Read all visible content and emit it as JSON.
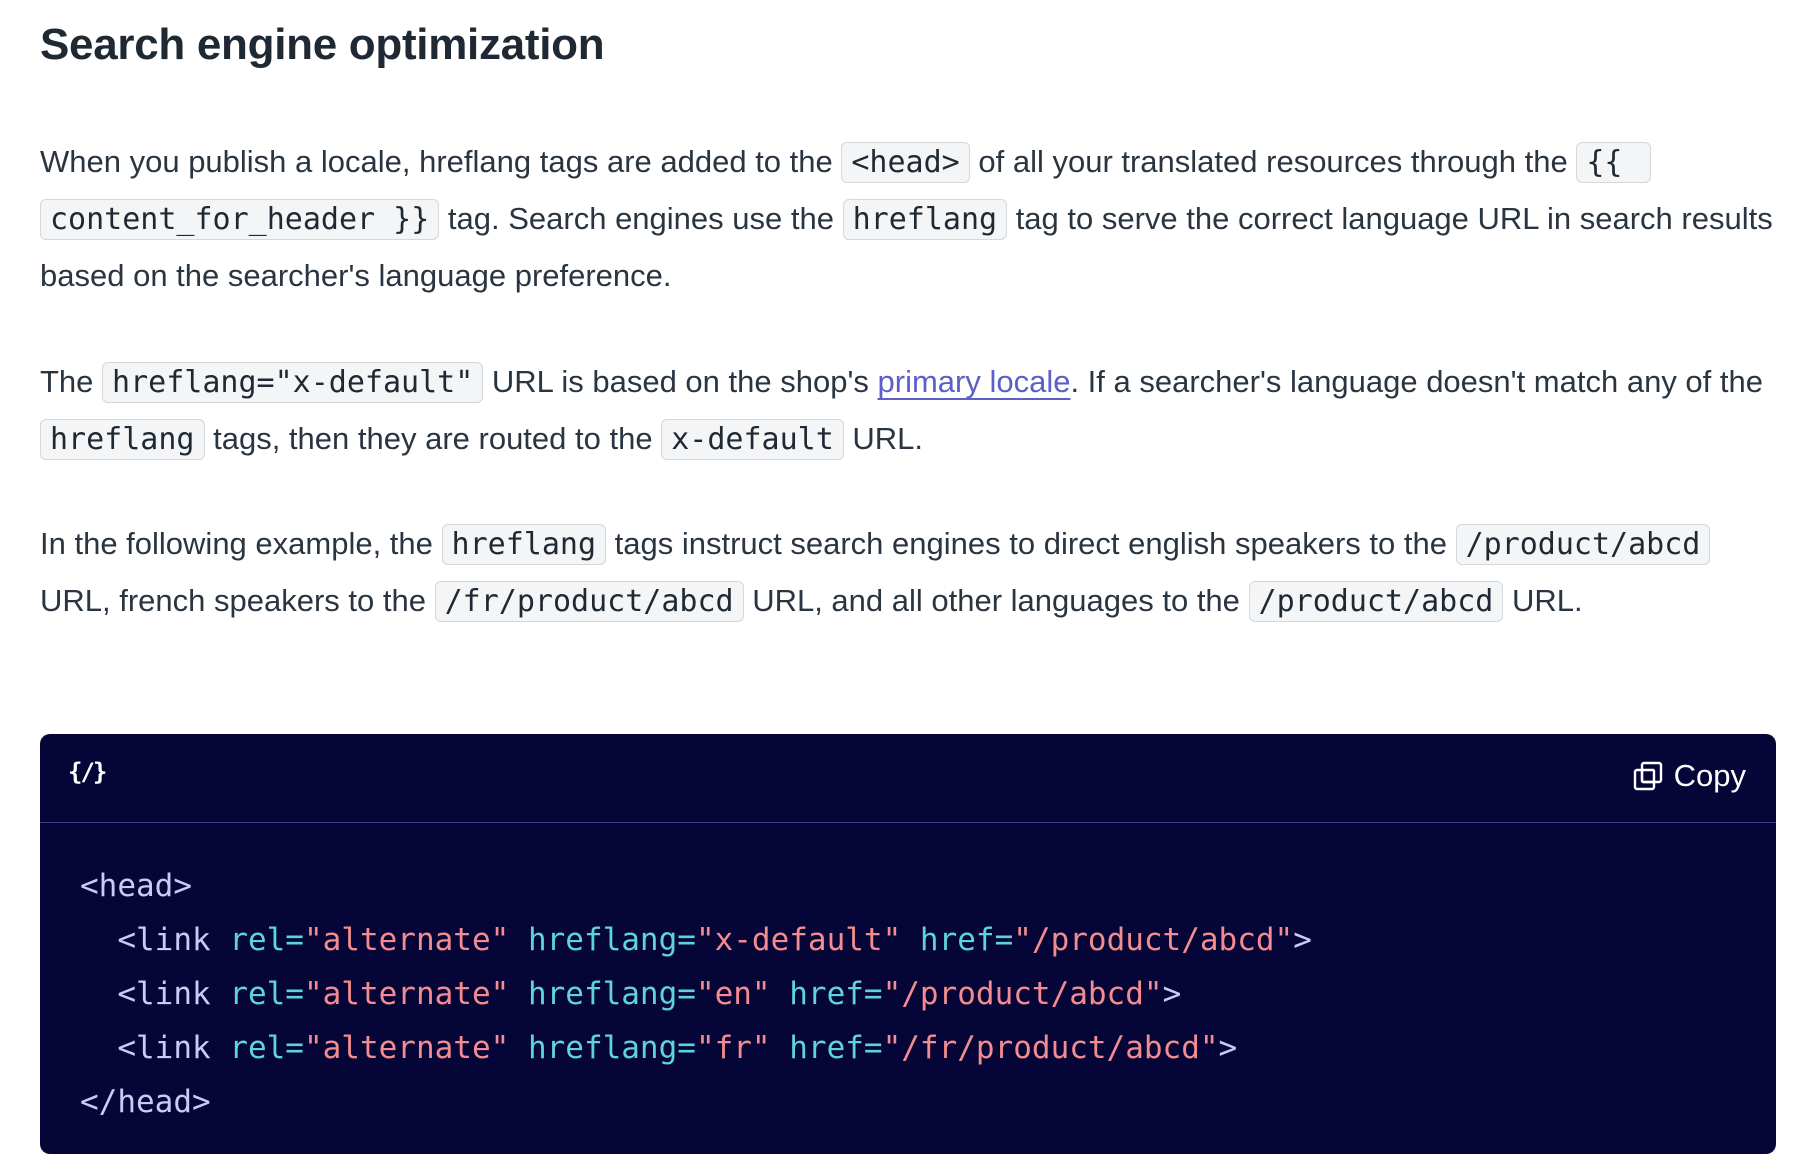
{
  "title": "Search engine optimization",
  "p1": {
    "t1": "When you publish a locale, hreflang tags are added to the ",
    "c1": "<head>",
    "t2": " of all your translated resources through the ",
    "c2": "{{ content_for_header }}",
    "t3": " tag. Search engines use the ",
    "c3": "hreflang",
    "t4": " tag to serve the correct language URL in search results based on the searcher's language preference."
  },
  "p2": {
    "t1": "The ",
    "c1": "hreflang=\"x-default\"",
    "t2": " URL is based on the shop's ",
    "link": "primary locale",
    "t3": ". If a searcher's language doesn't match any of the ",
    "c2": "hreflang",
    "t4": " tags, then they are routed to the ",
    "c3": "x-default",
    "t5": " URL."
  },
  "p3": {
    "t1": "In the following example, the ",
    "c1": "hreflang",
    "t2": " tags instruct search engines to direct english speakers to the ",
    "c2": "/product/abcd",
    "t3": " URL, french speakers to the ",
    "c3": "/fr/product/abcd",
    "t4": " URL, and all other languages to the ",
    "c4": "/product/abcd",
    "t5": " URL."
  },
  "codeblock": {
    "lang_icon_text": "{/}",
    "lang_icon": "code-braces-icon",
    "copy_icon": "copy-icon",
    "copy_label": "Copy",
    "lines": [
      {
        "indent": "",
        "tokens": [
          {
            "k": "tag",
            "v": "<head>"
          }
        ]
      },
      {
        "indent": "  ",
        "tokens": [
          {
            "k": "tag",
            "v": "<link "
          },
          {
            "k": "attr",
            "v": "rel="
          },
          {
            "k": "str",
            "v": "\"alternate\""
          },
          {
            "k": "punc",
            "v": " "
          },
          {
            "k": "attr",
            "v": "hreflang="
          },
          {
            "k": "str",
            "v": "\"x-default\""
          },
          {
            "k": "punc",
            "v": " "
          },
          {
            "k": "attr",
            "v": "href="
          },
          {
            "k": "str",
            "v": "\"/product/abcd\""
          },
          {
            "k": "tag",
            "v": ">"
          }
        ]
      },
      {
        "indent": "  ",
        "tokens": [
          {
            "k": "tag",
            "v": "<link "
          },
          {
            "k": "attr",
            "v": "rel="
          },
          {
            "k": "str",
            "v": "\"alternate\""
          },
          {
            "k": "punc",
            "v": " "
          },
          {
            "k": "attr",
            "v": "hreflang="
          },
          {
            "k": "str",
            "v": "\"en\""
          },
          {
            "k": "punc",
            "v": " "
          },
          {
            "k": "attr",
            "v": "href="
          },
          {
            "k": "str",
            "v": "\"/product/abcd\""
          },
          {
            "k": "tag",
            "v": ">"
          }
        ]
      },
      {
        "indent": "  ",
        "tokens": [
          {
            "k": "tag",
            "v": "<link "
          },
          {
            "k": "attr",
            "v": "rel="
          },
          {
            "k": "str",
            "v": "\"alternate\""
          },
          {
            "k": "punc",
            "v": " "
          },
          {
            "k": "attr",
            "v": "hreflang="
          },
          {
            "k": "str",
            "v": "\"fr\""
          },
          {
            "k": "punc",
            "v": " "
          },
          {
            "k": "attr",
            "v": "href="
          },
          {
            "k": "str",
            "v": "\"/fr/product/abcd\""
          },
          {
            "k": "tag",
            "v": ">"
          }
        ]
      },
      {
        "indent": "",
        "tokens": [
          {
            "k": "tag",
            "v": "</head>"
          }
        ]
      }
    ]
  },
  "colors": {
    "code_bg": "#050537",
    "code_attr": "#5fd3dc",
    "code_string": "#f38b8f",
    "code_tag": "#c8ccf2",
    "link": "#5b5fc7"
  }
}
